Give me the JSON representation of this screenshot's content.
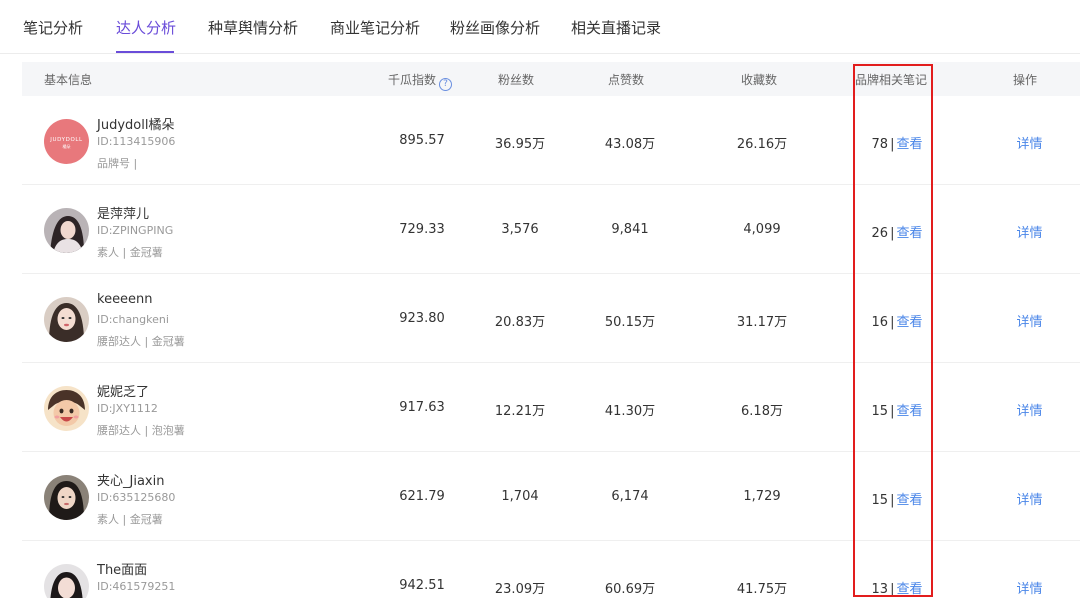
{
  "tabs": [
    {
      "label": "笔记分析"
    },
    {
      "label": "达人分析"
    },
    {
      "label": "种草舆情分析"
    },
    {
      "label": "商业笔记分析"
    },
    {
      "label": "粉丝画像分析"
    },
    {
      "label": "相关直播记录"
    }
  ],
  "active_tab": "达人分析",
  "table": {
    "headers": {
      "basic_info": "基本信息",
      "index": "千瓜指数",
      "fans": "粉丝数",
      "likes": "点赞数",
      "favorites": "收藏数",
      "brand_notes": "品牌相关笔记",
      "actions": "操作"
    },
    "help_icon": "?",
    "rows": [
      {
        "name": "Judydoll橘朵",
        "id": "ID:113415906",
        "tags": "品牌号 |",
        "avatar_text": "JUDYDOLL",
        "avatar_subtext": "橘朵",
        "index": "895.57",
        "fans": "36.95万",
        "likes": "43.08万",
        "favorites": "26.16万",
        "notes_count": "78",
        "view": "查看",
        "detail": "详情"
      },
      {
        "name": "是萍萍儿",
        "id": "ID:ZPINGPING",
        "tags": "素人 | 金冠薯",
        "index": "729.33",
        "fans": "3,576",
        "likes": "9,841",
        "favorites": "4,099",
        "notes_count": "26",
        "view": "查看",
        "detail": "详情"
      },
      {
        "name": "keeeenn",
        "id": "ID:changkeni",
        "tags": "腰部达人 | 金冠薯",
        "index": "923.80",
        "fans": "20.83万",
        "likes": "50.15万",
        "favorites": "31.17万",
        "notes_count": "16",
        "view": "查看",
        "detail": "详情"
      },
      {
        "name": "妮妮乏了",
        "id": "ID:JXY1112",
        "tags": "腰部达人 | 泡泡薯",
        "index": "917.63",
        "fans": "12.21万",
        "likes": "41.30万",
        "favorites": "6.18万",
        "notes_count": "15",
        "view": "查看",
        "detail": "详情"
      },
      {
        "name": "夹心_Jiaxin",
        "id": "ID:635125680",
        "tags": "素人 | 金冠薯",
        "index": "621.79",
        "fans": "1,704",
        "likes": "6,174",
        "favorites": "1,729",
        "notes_count": "15",
        "view": "查看",
        "detail": "详情"
      },
      {
        "name": "The面面",
        "id": "ID:461579251",
        "tags": "",
        "index": "942.51",
        "fans": "23.09万",
        "likes": "60.69万",
        "favorites": "41.75万",
        "notes_count": "13",
        "view": "查看",
        "detail": "详情"
      }
    ]
  },
  "colors": {
    "accent": "#6a4cd9",
    "link": "#4a86e8",
    "highlight": "#e21d1d",
    "brand_avatar_bg": "#e8787c"
  },
  "icons": {
    "help": "question-circle-icon"
  }
}
